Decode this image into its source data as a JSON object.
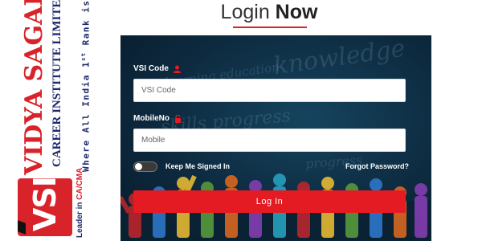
{
  "brand": {
    "logo": "VSI",
    "name": "VIDYA SAGAR",
    "trademark": "®",
    "subtitle": "CAREER INSTITUTE LIMITED",
    "leader_prefix": "Leader in",
    "leader_highlight": "CA/CMA",
    "tagline_before": "Where All India 1",
    "tagline_sup": "st",
    "tagline_after": " Rank is a Tradition"
  },
  "header": {
    "title_light": "Login ",
    "title_bold": "Now"
  },
  "form": {
    "code_label": "VSI Code",
    "code_placeholder": "VSI Code",
    "code_value": "",
    "mobile_label": "MobileNo",
    "mobile_placeholder": "Mobile",
    "mobile_value": "",
    "keep_signed_in_label": "Keep Me Signed In",
    "keep_signed_in": false,
    "forgot_password": "Forgot Password?",
    "login_button": "Log In"
  },
  "colors": {
    "accent": "#e51b23",
    "brand_red": "#d8232a",
    "brand_navy": "#1e2a6b",
    "panel_bg": "#0d2a3f"
  },
  "icons": {
    "code_label_icon": "user-icon",
    "mobile_label_icon": "lock-icon"
  }
}
